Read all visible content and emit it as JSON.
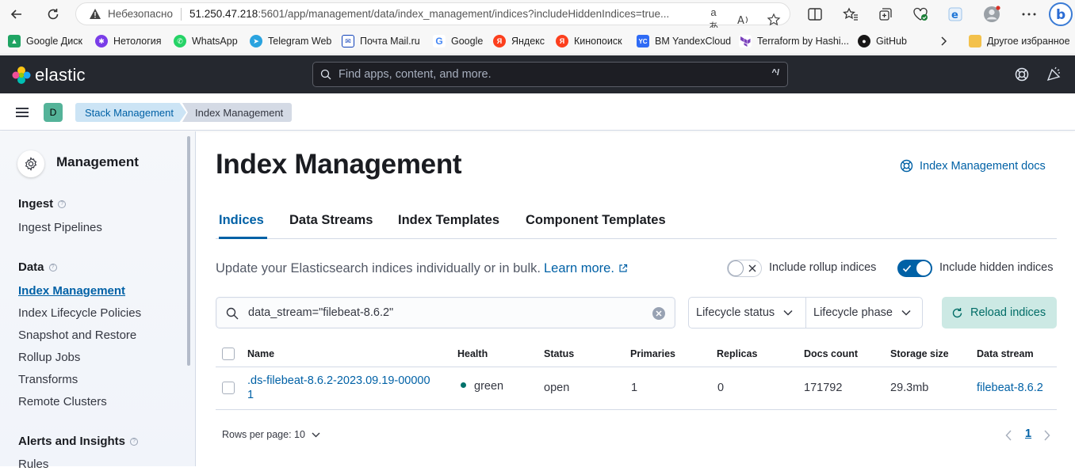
{
  "browser": {
    "security_label": "Небезопасно",
    "url_host": "51.250.47.218",
    "url_rest": ":5601/app/management/data/index_management/indices?includeHiddenIndices=true...",
    "read_aloud_label": "aあ",
    "bookmarks": [
      {
        "label": "Google Диск",
        "color": "#1fa463",
        "icon": "google-drive-icon"
      },
      {
        "label": "Нетология",
        "color": "#7a3de8",
        "icon": "netology-icon"
      },
      {
        "label": "WhatsApp",
        "color": "#25d366",
        "icon": "whatsapp-icon"
      },
      {
        "label": "Telegram Web",
        "color": "#2aa3df",
        "icon": "telegram-icon"
      },
      {
        "label": "Почта Mail.ru",
        "color": "#0d3fb8",
        "icon": "mail-icon"
      },
      {
        "label": "Google",
        "color": "#4285f4",
        "icon": "google-icon"
      },
      {
        "label": "Яндекс",
        "color": "#fc3f1d",
        "icon": "yandex-icon"
      },
      {
        "label": "Кинопоиск",
        "color": "#fc3f1d",
        "icon": "kinopoisk-icon"
      },
      {
        "label": "BM YandexCloud",
        "color": "#2f6bf5",
        "icon": "yandex-cloud-icon"
      },
      {
        "label": "Terraform by Hashi...",
        "color": "#7b42bc",
        "icon": "terraform-icon"
      },
      {
        "label": "GitHub",
        "color": "#181717",
        "icon": "github-icon"
      }
    ],
    "other_bookmarks": "Другое избранное"
  },
  "kibana": {
    "logo_text": "elastic",
    "search_placeholder": "Find apps, content, and more.",
    "search_shortcut": "^/",
    "space_initial": "D",
    "breadcrumbs": [
      "Stack Management",
      "Index Management"
    ]
  },
  "sidenav": {
    "title": "Management",
    "groups": [
      {
        "label": "Ingest",
        "items": [
          "Ingest Pipelines"
        ]
      },
      {
        "label": "Data",
        "items": [
          "Index Management",
          "Index Lifecycle Policies",
          "Snapshot and Restore",
          "Rollup Jobs",
          "Transforms",
          "Remote Clusters"
        ]
      },
      {
        "label": "Alerts and Insights",
        "items": [
          "Rules"
        ]
      }
    ],
    "active_item": "Index Management"
  },
  "main": {
    "title": "Index Management",
    "docs_link": "Index Management docs",
    "tabs": [
      "Indices",
      "Data Streams",
      "Index Templates",
      "Component Templates"
    ],
    "selected_tab": "Indices",
    "description": "Update your Elasticsearch indices individually or in bulk.",
    "learn_more": "Learn more.",
    "toggles": [
      {
        "label": "Include rollup indices",
        "checked": false
      },
      {
        "label": "Include hidden indices",
        "checked": true
      }
    ],
    "search_value": "data_stream=\"filebeat-8.6.2\"",
    "filters": [
      "Lifecycle status",
      "Lifecycle phase"
    ],
    "reload_label": "Reload indices",
    "table": {
      "columns": [
        "Name",
        "Health",
        "Status",
        "Primaries",
        "Replicas",
        "Docs count",
        "Storage size",
        "Data stream"
      ],
      "rows": [
        {
          "name_line1": ".ds-filebeat-8.6.2-2023.09.19-00000",
          "name_line2": "1",
          "health": "green",
          "status": "open",
          "primaries": "1",
          "replicas": "0",
          "docs_count": "171792",
          "storage_size": "29.3mb",
          "data_stream": "filebeat-8.6.2"
        }
      ]
    },
    "rows_per_page_label": "Rows per page: 10",
    "current_page": "1",
    "colors": {
      "accent": "#0061a6",
      "health_green": "#00726b",
      "header_bg": "#25282f"
    }
  }
}
